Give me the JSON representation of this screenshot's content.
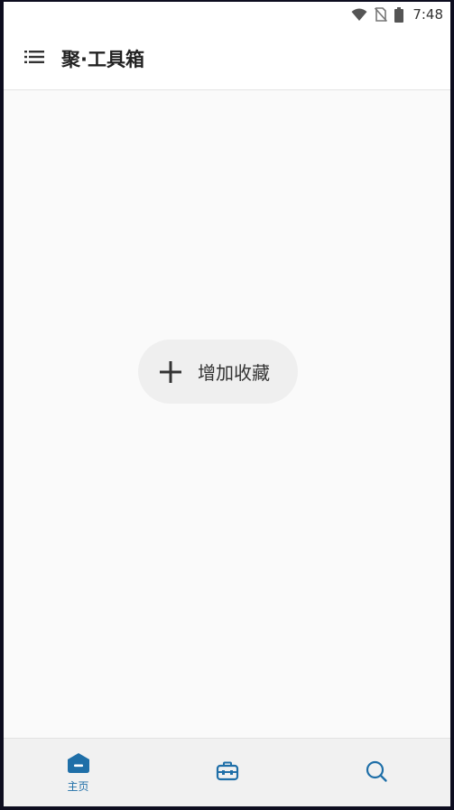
{
  "status_bar": {
    "time": "7:48",
    "icons": [
      "wifi-icon",
      "no-sim-icon",
      "battery-icon"
    ]
  },
  "app_bar": {
    "menu_icon": "menu-list-icon",
    "title": "聚·工具箱"
  },
  "main": {
    "add_favorite": {
      "icon": "plus-icon",
      "label": "增加收藏"
    }
  },
  "bottom_nav": {
    "items": [
      {
        "icon": "home-icon",
        "label": "主页",
        "active": true
      },
      {
        "icon": "toolbox-icon",
        "label": ""
      },
      {
        "icon": "search-icon",
        "label": ""
      }
    ]
  },
  "colors": {
    "accent": "#1f6fa8",
    "background": "#fafafa",
    "app_bar": "#ffffff",
    "bottom_nav": "#f1f1f1",
    "button_bg": "#efefef"
  }
}
